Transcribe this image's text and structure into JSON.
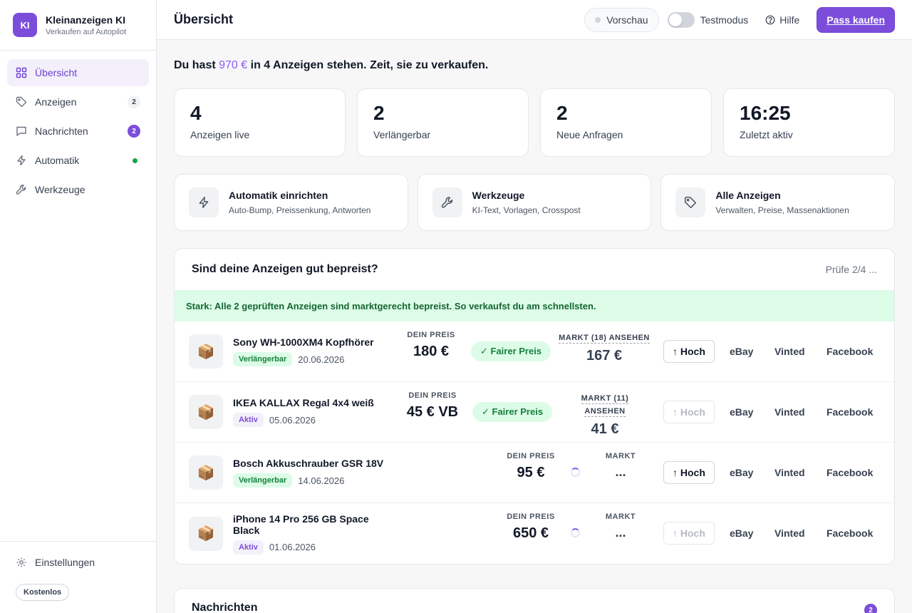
{
  "brand": {
    "logo": "KI",
    "name": "Kleinanzeigen KI",
    "subtitle": "Verkaufen auf Autopilot"
  },
  "sidebar": {
    "items": [
      {
        "label": "Übersicht",
        "icon": "grid-icon",
        "active": true
      },
      {
        "label": "Anzeigen",
        "icon": "tag-icon",
        "count": "2"
      },
      {
        "label": "Nachrichten",
        "icon": "message-icon",
        "count": "2"
      },
      {
        "label": "Automatik",
        "icon": "bolt-icon",
        "status": "online"
      },
      {
        "label": "Werkzeuge",
        "icon": "wrench-icon"
      }
    ],
    "settings_label": "Einstellungen",
    "plan_badge": "Kostenlos"
  },
  "header": {
    "title": "Übersicht",
    "preview_label": "Vorschau",
    "testmode_label": "Testmodus",
    "testmode_on": false,
    "help_label": "Hilfe",
    "buy_label": "Pass kaufen"
  },
  "summary": {
    "prefix": "Du hast",
    "amount": "970 €",
    "suffix": "in 4 Anzeigen stehen. Zeit, sie zu verkaufen."
  },
  "stats": [
    {
      "value": "4",
      "label": "Anzeigen live"
    },
    {
      "value": "2",
      "label": "Verlängerbar"
    },
    {
      "value": "2",
      "label": "Neue Anfragen"
    },
    {
      "value": "16:25",
      "label": "Zuletzt aktiv"
    }
  ],
  "actions": [
    {
      "title": "Automatik einrichten",
      "subtitle": "Auto-Bump, Preissenkung, Antworten",
      "icon": "bolt-icon"
    },
    {
      "title": "Werkzeuge",
      "subtitle": "KI-Text, Vorlagen, Crosspost",
      "icon": "wrench-icon"
    },
    {
      "title": "Alle Anzeigen",
      "subtitle": "Verwalten, Preise, Massenaktionen",
      "icon": "tag-icon"
    }
  ],
  "pricing": {
    "title": "Sind deine Anzeigen gut bepreist?",
    "progress": "Prüfe 2/4 ...",
    "banner": "Stark: Alle 2 geprüften Anzeigen sind marktgerecht bepreist. So verkaufst du am schnellsten.",
    "price_caption": "DEIN PREIS",
    "fair_label": "✓ Fairer Preis",
    "market_caption": "MARKT",
    "bump_label": "↑ Hoch",
    "platforms": [
      "eBay",
      "Vinted",
      "Facebook"
    ],
    "listings": [
      {
        "title": "Sony WH-1000XM4 Kopfhörer",
        "status": "Verlängerbar",
        "status_color": "green",
        "date": "20.06.2026",
        "price": "180 €",
        "fair": true,
        "market_caption": "MARKT (18) ANSEHEN",
        "market": "167 €",
        "bump_enabled": true
      },
      {
        "title": "IKEA KALLAX Regal 4x4 weiß",
        "status": "Aktiv",
        "status_color": "purple",
        "date": "05.06.2026",
        "price": "45 € VB",
        "fair": true,
        "market_caption": "MARKT (11) ANSEHEN",
        "market": "41 €",
        "bump_enabled": false
      },
      {
        "title": "Bosch Akkuschrauber GSR 18V",
        "status": "Verlängerbar",
        "status_color": "green",
        "date": "14.06.2026",
        "price": "95 €",
        "fair": false,
        "market_caption": "MARKT",
        "market": "...",
        "bump_enabled": true
      },
      {
        "title": "iPhone 14 Pro 256 GB Space Black",
        "status": "Aktiv",
        "status_color": "purple",
        "date": "01.06.2026",
        "price": "650 €",
        "fair": false,
        "market_caption": "MARKT",
        "market": "...",
        "bump_enabled": false
      }
    ]
  },
  "messages": {
    "title": "Nachrichten",
    "count": "2"
  },
  "colors": {
    "accent": "#7c4ddb",
    "success_bg": "#dcfce7",
    "success_text": "#15803d"
  }
}
